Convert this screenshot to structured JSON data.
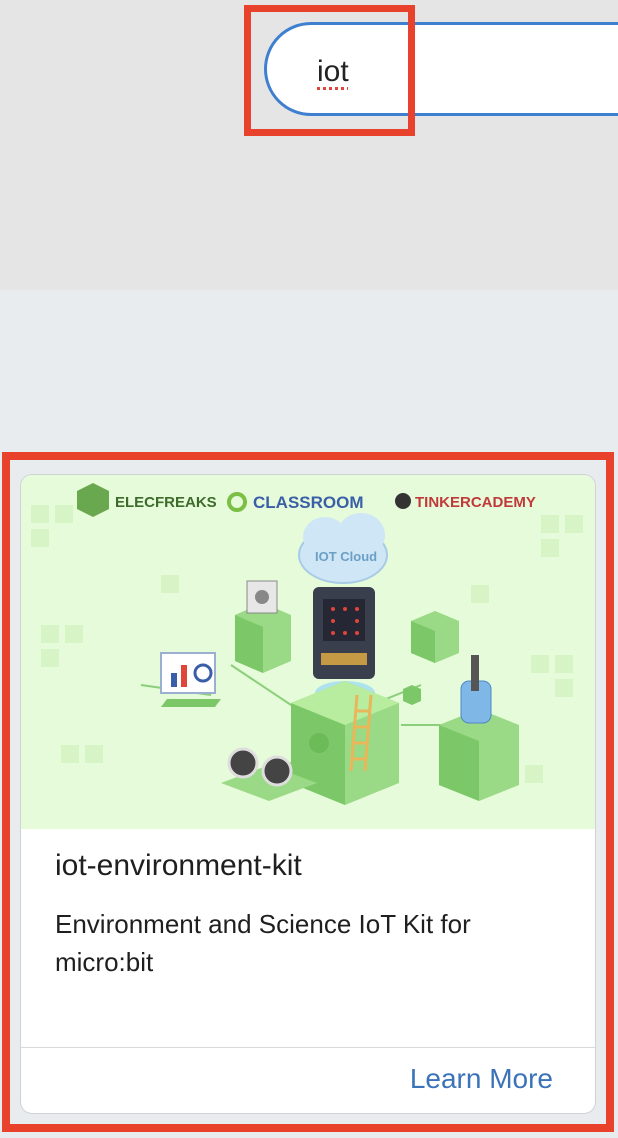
{
  "search": {
    "query": "iot"
  },
  "card": {
    "brands": [
      "ELECFREAKS",
      "CLASSROOM",
      "TINKERCADEMY"
    ],
    "cloud_label": "IOT Cloud",
    "title": "iot-environment-kit",
    "description": "Environment and Science IoT Kit for micro:bit",
    "action_label": "Learn More"
  },
  "colors": {
    "highlight": "#e8412c",
    "search_border": "#3f7fd0",
    "link": "#3b73b9",
    "card_image_bg": "#e6fbd9"
  }
}
